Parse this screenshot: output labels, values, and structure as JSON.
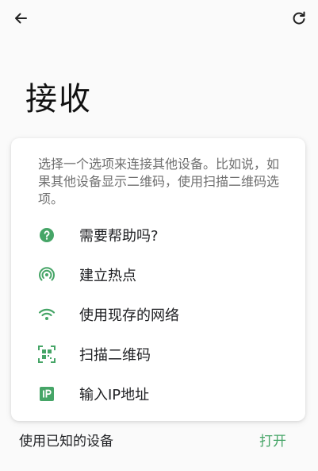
{
  "header": {
    "back_icon": "arrow-left-icon",
    "refresh_icon": "refresh-icon"
  },
  "page_title": "接收",
  "card": {
    "description": "选择一个选项来连接其他设备。比如说，如果其他设备显示二维码，使用扫描二维码选项。",
    "options": [
      {
        "label": "需要帮助吗?",
        "icon": "help-circle-icon"
      },
      {
        "label": "建立热点",
        "icon": "hotspot-icon"
      },
      {
        "label": "使用现存的网络",
        "icon": "wifi-icon"
      },
      {
        "label": "扫描二维码",
        "icon": "qr-scan-icon"
      },
      {
        "label": "输入IP地址",
        "icon": "ip-icon"
      }
    ]
  },
  "footer": {
    "label": "使用已知的设备",
    "action": "打开"
  },
  "colors": {
    "accent": "#46a567",
    "text": "#202124",
    "muted": "#6f6f6f"
  }
}
